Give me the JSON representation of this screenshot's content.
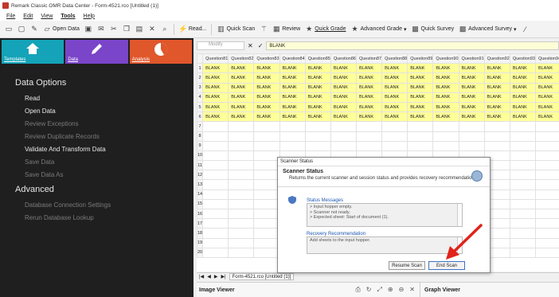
{
  "window": {
    "title": "Remark Classic OMR Data Center - Form-4521.rco [Untitled (1)]"
  },
  "menu": [
    "File",
    "Edit",
    "View",
    "Tools",
    "Help"
  ],
  "toolbar": {
    "open_data": "Open Data",
    "read": "Read...",
    "quick_scan": "Quick Scan",
    "review": "Review",
    "quick_grade": "Quick Grade",
    "advanced_grade": "Advanced Grade",
    "quick_survey": "Quick Survey",
    "advanced_survey": "Advanced Survey"
  },
  "tiles": {
    "templates": "Templates",
    "data": "Data",
    "analysis": "Analysis"
  },
  "sidebar": {
    "section_title": "Data Options",
    "items": [
      {
        "label": "Read",
        "enabled": true
      },
      {
        "label": "Open Data",
        "enabled": true
      },
      {
        "label": "Review Exceptions",
        "enabled": false
      },
      {
        "label": "Review Duplicate Records",
        "enabled": false
      },
      {
        "label": "Validate And Transform Data",
        "enabled": true
      },
      {
        "label": "Save Data",
        "enabled": false
      },
      {
        "label": "Save Data As",
        "enabled": false
      }
    ],
    "advanced_title": "Advanced",
    "advanced_items": [
      {
        "label": "Database Connection Settings",
        "enabled": false
      },
      {
        "label": "Rerun Database Lookup",
        "enabled": false
      }
    ]
  },
  "formula": {
    "namebox": "Modify",
    "value": "BLANK"
  },
  "grid": {
    "columns": [
      "Question81",
      "Question82",
      "Question83",
      "Question84",
      "Question85",
      "Question86",
      "Question87",
      "Question88",
      "Question89",
      "Question90",
      "Question91",
      "Question92",
      "Question93",
      "Question94"
    ],
    "filled_value": "BLANK",
    "filled_rows": 6,
    "total_rows": 20
  },
  "sheet_tab": "Form-4521.rco [Untitled (1)]",
  "viewers": {
    "image": "Image Viewer",
    "graph": "Graph Viewer"
  },
  "dialog": {
    "window_title": "Scanner Status",
    "heading": "Scanner Status",
    "description": "Returns the current scanner and session status and provides recovery recommendations.",
    "status_label": "Status Messages",
    "status_lines": [
      "> Input hopper empty.",
      "> Scanner not ready.",
      "> Expected sheet: Start of document (1)."
    ],
    "recovery_label": "Recovery Recommendation",
    "recovery_text": "Add sheets to the input hopper.",
    "resume_button": "Resume Scan",
    "end_button": "End Scan"
  },
  "colors": {
    "templates": "#14a3b8",
    "data": "#7a45c9",
    "analysis": "#e0572b",
    "highlight": "#ffff99",
    "arrow": "#e0231b"
  }
}
